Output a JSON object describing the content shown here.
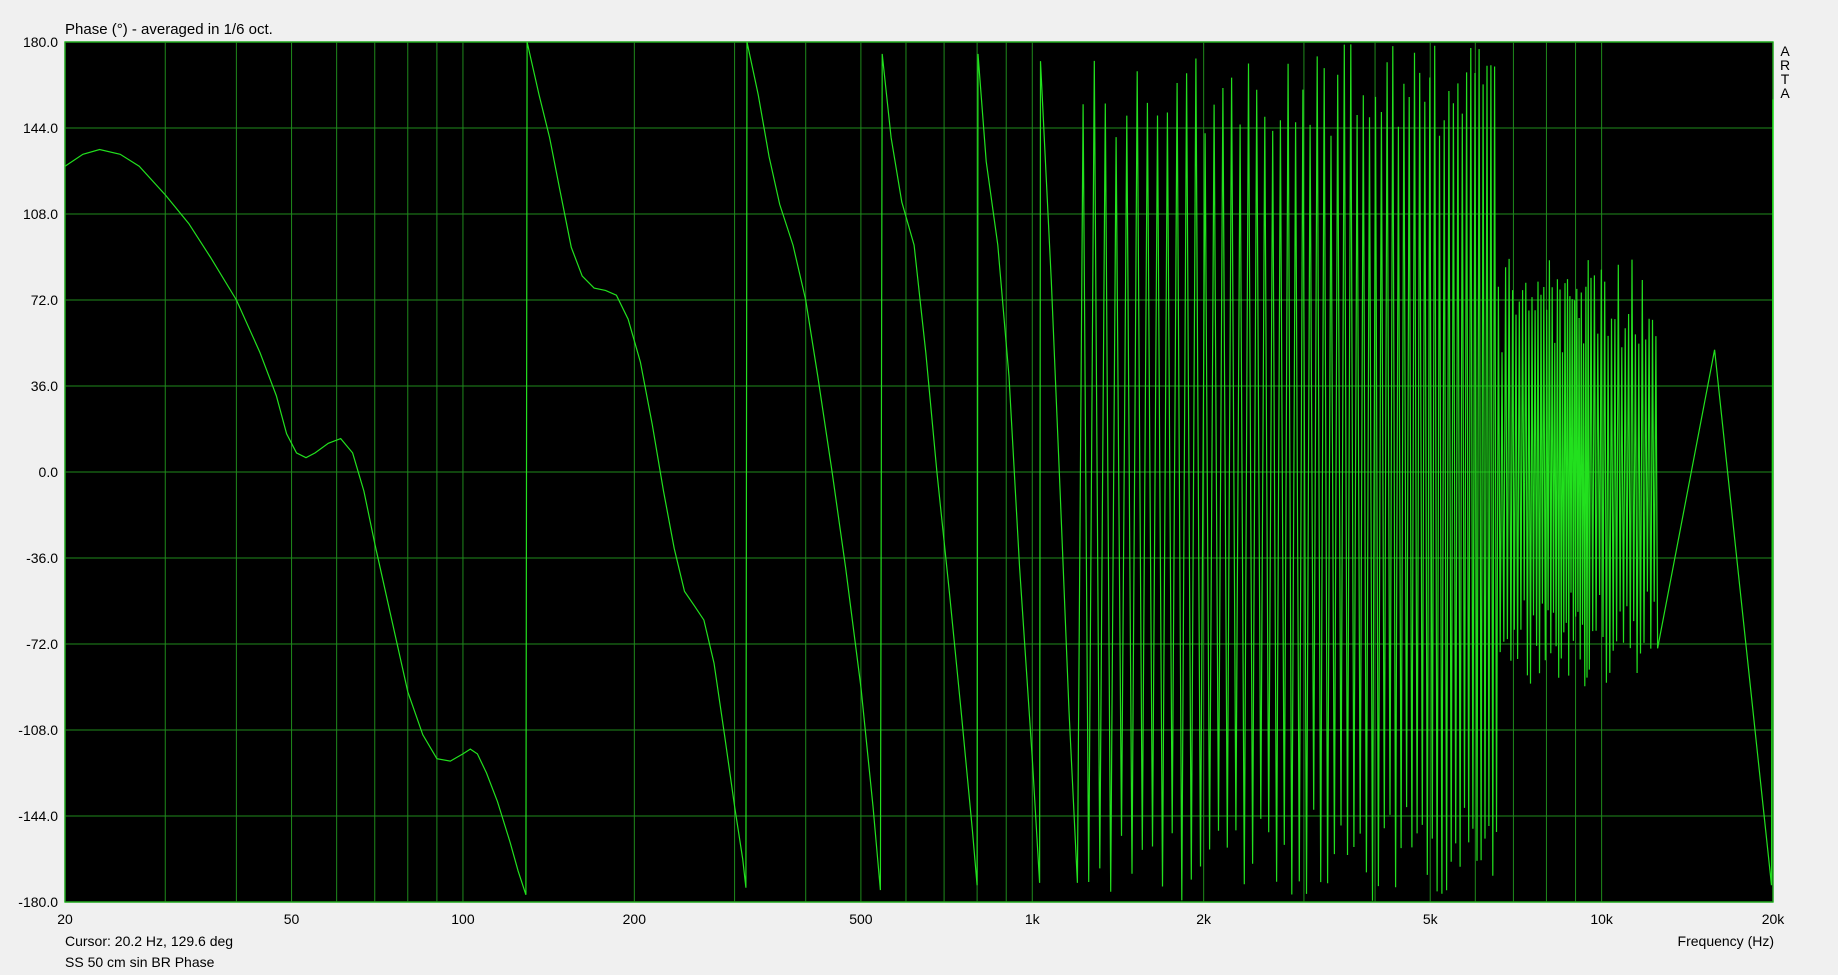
{
  "chart_data": {
    "type": "line",
    "title": "Phase (°) - averaged in 1/6 oct.",
    "xlabel": "Frequency (Hz)",
    "ylabel": "",
    "x_scale": "log",
    "xlim": [
      20,
      20000
    ],
    "ylim": [
      -180,
      180
    ],
    "y_ticks": [
      "180.0",
      "144.0",
      "108.0",
      "72.0",
      "36.0",
      "0.0",
      "-36.0",
      "-72.0",
      "-108.0",
      "-144.0",
      "-180.0"
    ],
    "x_ticks": [
      {
        "value": 20,
        "label": "20"
      },
      {
        "value": 50,
        "label": "50"
      },
      {
        "value": 100,
        "label": "100"
      },
      {
        "value": 200,
        "label": "200"
      },
      {
        "value": 500,
        "label": "500"
      },
      {
        "value": 1000,
        "label": "1k"
      },
      {
        "value": 2000,
        "label": "2k"
      },
      {
        "value": 5000,
        "label": "5k"
      },
      {
        "value": 10000,
        "label": "10k"
      },
      {
        "value": 20000,
        "label": "20k"
      }
    ],
    "grid": true,
    "series": [
      {
        "color": "#22e01e",
        "points": [
          [
            20,
            128
          ],
          [
            21.5,
            133
          ],
          [
            23,
            135
          ],
          [
            25,
            133
          ],
          [
            27,
            128
          ],
          [
            30,
            116
          ],
          [
            33,
            104
          ],
          [
            36,
            90
          ],
          [
            40,
            72
          ],
          [
            44,
            50
          ],
          [
            47,
            32
          ],
          [
            49,
            16
          ],
          [
            51,
            8
          ],
          [
            53,
            6
          ],
          [
            55,
            8
          ],
          [
            58,
            12
          ],
          [
            61,
            14
          ],
          [
            64,
            8
          ],
          [
            67,
            -8
          ],
          [
            70,
            -30
          ],
          [
            75,
            -62
          ],
          [
            80,
            -92
          ],
          [
            85,
            -110
          ],
          [
            90,
            -120
          ],
          [
            95,
            -121
          ],
          [
            100,
            -118
          ],
          [
            103,
            -116
          ],
          [
            106,
            -118
          ],
          [
            110,
            -126
          ],
          [
            115,
            -138
          ],
          [
            121,
            -155
          ],
          [
            125,
            -167
          ],
          [
            129,
            -177
          ],
          [
            129.6,
            180
          ],
          [
            136,
            158
          ],
          [
            142,
            140
          ],
          [
            148,
            118
          ],
          [
            155,
            94
          ],
          [
            162,
            82
          ],
          [
            170,
            77
          ],
          [
            178,
            76
          ],
          [
            186,
            74
          ],
          [
            195,
            64
          ],
          [
            205,
            46
          ],
          [
            215,
            20
          ],
          [
            225,
            -8
          ],
          [
            235,
            -32
          ],
          [
            245,
            -50
          ],
          [
            255,
            -56
          ],
          [
            265,
            -62
          ],
          [
            276,
            -80
          ],
          [
            288,
            -110
          ],
          [
            300,
            -140
          ],
          [
            310,
            -162
          ],
          [
            314,
            -174
          ],
          [
            315.5,
            180
          ],
          [
            330,
            158
          ],
          [
            345,
            132
          ],
          [
            360,
            112
          ],
          [
            380,
            95
          ],
          [
            400,
            72
          ],
          [
            420,
            40
          ],
          [
            445,
            0
          ],
          [
            470,
            -40
          ],
          [
            500,
            -90
          ],
          [
            525,
            -140
          ],
          [
            541,
            -175
          ],
          [
            545,
            175
          ],
          [
            565,
            140
          ],
          [
            590,
            113
          ],
          [
            620,
            95
          ],
          [
            650,
            50
          ],
          [
            680,
            0
          ],
          [
            715,
            -50
          ],
          [
            750,
            -100
          ],
          [
            785,
            -150
          ],
          [
            800,
            -173
          ],
          [
            803,
            175
          ],
          [
            830,
            130
          ],
          [
            870,
            95
          ],
          [
            910,
            40
          ],
          [
            950,
            -40
          ],
          [
            1000,
            -120
          ],
          [
            1030,
            -172
          ],
          [
            1034,
            172
          ],
          [
            1080,
            80
          ],
          [
            1120,
            -10
          ],
          [
            1160,
            -100
          ],
          [
            1200,
            -172
          ]
        ]
      }
    ]
  },
  "labels": {
    "cursor": "Cursor: 20.2 Hz, 129.6 deg",
    "caption": "SS 50 cm sin BR Phase",
    "badge": "ARTA"
  }
}
